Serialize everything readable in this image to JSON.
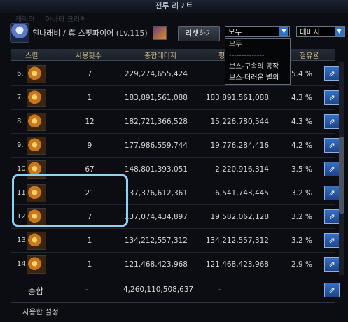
{
  "window": {
    "title": "전투 리포트"
  },
  "ghost_tabs": [
    "캐릭터",
    "아바타 크리처"
  ],
  "player": {
    "name": "흰나래비 / 真 스핏파이어",
    "level": "(Lv.115)"
  },
  "reset_label": "리셋하기",
  "target_select": {
    "value": "모두"
  },
  "metric_select": {
    "value": "데미지"
  },
  "dropdown_options": [
    "모두",
    "--------------",
    "보스-구속의 공작",
    "보스-더러운 별의"
  ],
  "columns": {
    "skill": "스킬",
    "count": "사용횟수",
    "total": "총합데미지",
    "avg": "평",
    "share": "점유율"
  },
  "rows": [
    {
      "rank": "6.",
      "count": "7",
      "total": "229,274,655,424",
      "avg": "32,7",
      "pct": "5.4 %"
    },
    {
      "rank": "7.",
      "count": "1",
      "total": "183,891,561,088",
      "avg": "183,891,561,088",
      "pct": "4.3 %"
    },
    {
      "rank": "8.",
      "count": "12",
      "total": "182,721,366,528",
      "avg": "15,226,780,544",
      "pct": "4.3 %"
    },
    {
      "rank": "9.",
      "count": "9",
      "total": "177,986,559,744",
      "avg": "19,776,284,416",
      "pct": "4.2 %"
    },
    {
      "rank": "10.",
      "count": "67",
      "total": "148,801,393,051",
      "avg": "2,220,916,314",
      "pct": "3.5 %"
    },
    {
      "rank": "11.",
      "count": "21",
      "total": "137,376,612,361",
      "avg": "6,541,743,445",
      "pct": "3.2 %"
    },
    {
      "rank": "12.",
      "count": "7",
      "total": "137,074,434,897",
      "avg": "19,582,062,128",
      "pct": "3.2 %"
    },
    {
      "rank": "13.",
      "count": "1",
      "total": "134,212,557,312",
      "avg": "134,212,557,312",
      "pct": "3.2 %"
    },
    {
      "rank": "14.",
      "count": "1",
      "total": "121,468,423,968",
      "avg": "121,468,423,968",
      "pct": "2.9 %"
    }
  ],
  "total": {
    "label": "총합",
    "count": "-",
    "total": "4,260,110,508,637",
    "avg": "-"
  },
  "settings_label": "사용한 설정",
  "icons": {
    "share": "share-icon",
    "dropdown": "chevron-down-icon"
  },
  "colors": {
    "accent": "#2f73c9",
    "highlight": "#8fd3f4",
    "header_text": "#cdbb88"
  }
}
